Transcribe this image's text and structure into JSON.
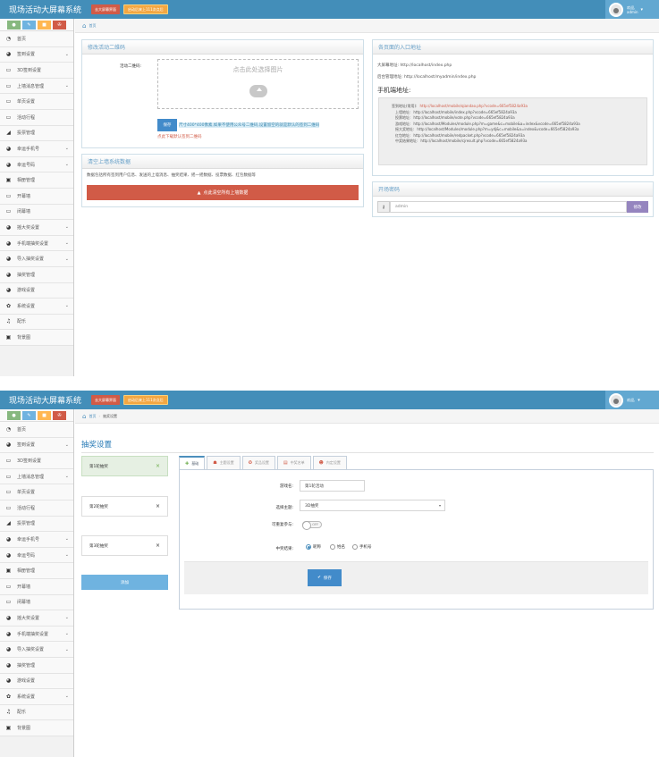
{
  "app": {
    "title": "现场活动大屏幕系统",
    "btn_screen": "去大屏幕界面",
    "btn_hint": "启动后来上111次点后",
    "user_greeting": "欢迎,",
    "user_name": "admin"
  },
  "sidebar": {
    "items": [
      {
        "icon": "tachometer-icon",
        "glyph": "◔",
        "label": "首页",
        "arrow": false
      },
      {
        "icon": "users-icon",
        "glyph": "◕",
        "label": "签到设置",
        "arrow": true
      },
      {
        "icon": "desktop-icon",
        "glyph": "▭",
        "label": "3D签到设置",
        "arrow": false
      },
      {
        "icon": "desktop-icon",
        "glyph": "▭",
        "label": "上墙消息管理",
        "arrow": true
      },
      {
        "icon": "desktop-icon",
        "glyph": "▭",
        "label": "单页设置",
        "arrow": false
      },
      {
        "icon": "desktop-icon",
        "glyph": "▭",
        "label": "活动行程",
        "arrow": false
      },
      {
        "icon": "bar-chart-icon",
        "glyph": "◢",
        "label": "投票管理",
        "arrow": false
      },
      {
        "icon": "users-icon",
        "glyph": "◕",
        "label": "幸运手机号",
        "arrow": true
      },
      {
        "icon": "users-icon",
        "glyph": "◕",
        "label": "幸运号码",
        "arrow": true
      },
      {
        "icon": "picture-icon",
        "glyph": "▣",
        "label": "相册管理",
        "arrow": false
      },
      {
        "icon": "desktop-icon",
        "glyph": "▭",
        "label": "开幕墙",
        "arrow": false
      },
      {
        "icon": "desktop-icon",
        "glyph": "▭",
        "label": "闭幕墙",
        "arrow": false
      },
      {
        "icon": "users-icon",
        "glyph": "◕",
        "label": "摇大奖设置",
        "arrow": true
      },
      {
        "icon": "users-icon",
        "glyph": "◕",
        "label": "手机端抽奖设置",
        "arrow": true
      },
      {
        "icon": "users-icon",
        "glyph": "◕",
        "label": "导入抽奖设置",
        "arrow": true
      },
      {
        "icon": "users-icon",
        "glyph": "◕",
        "label": "抽奖管理",
        "arrow": false
      },
      {
        "icon": "users-icon",
        "glyph": "◕",
        "label": "游戏设置",
        "arrow": false
      },
      {
        "icon": "gear-icon",
        "glyph": "✿",
        "label": "系统设置",
        "arrow": true
      },
      {
        "icon": "music-icon",
        "glyph": "♫",
        "label": "配乐",
        "arrow": false
      },
      {
        "icon": "picture-icon",
        "glyph": "▣",
        "label": "背景图",
        "arrow": false
      }
    ]
  },
  "shortcuts": [
    {
      "icon": "signal-icon",
      "glyph": "●",
      "color": "#87b87f"
    },
    {
      "icon": "pencil-icon",
      "glyph": "✎",
      "color": "#6fb3e0"
    },
    {
      "icon": "group-icon",
      "glyph": "■",
      "color": "#ffb752"
    },
    {
      "icon": "cogs-icon",
      "glyph": "✇",
      "color": "#d15b47"
    }
  ],
  "screen1": {
    "breadcrumb": {
      "home": "首页"
    },
    "qr": {
      "title": "修改活动二维码",
      "label": "活动二维码:",
      "upload_text": "点击此处选择图片",
      "save": "保存",
      "note": "尺寸400*400像素,如果不使用公众号二维码,设置留空的就是默认的签到二维码",
      "default_link": "点此下载默认签到二维码"
    },
    "clear": {
      "title": "清空上墙系统数据",
      "desc": "数据包括所有签到用户信息、发送的上墙消息、抽奖结果、摇一摇数据、投票数据、红包数据等",
      "button": "点此清空所有上墙数据"
    },
    "entry": {
      "title": "各页面的入口地址",
      "screen_addr": "大屏幕地址:  http://localhost/index.php",
      "admin_addr": "后台管理地址:  http://localhost/myadmin/index.php",
      "mobile_title": "手机端地址:",
      "lines": [
        {
          "label": "签到地址(常用):",
          "url": "http://localhost/mobile/qiandao.php?vcode=665ef5824a93a",
          "red": true
        },
        {
          "label": "上墙地址:",
          "url": "http://localhost/mobile/index.php?vcode=665ef5824a93a",
          "red": false
        },
        {
          "label": "投票地址:",
          "url": "http://localhost/mobile/vote.php?vcode=665ef5824a93a",
          "red": false
        },
        {
          "label": "游戏地址:",
          "url": "http://localhost/Modules/module.php?m=game&c=mobile&a=index&vcode=665ef5824a93a",
          "red": false
        },
        {
          "label": "摇大奖地址:",
          "url": "http://localhost/Modules/module.php?m=ydj&c=mobile&a=index&vcode=665ef5824a93a",
          "red": false
        },
        {
          "label": "红包地址:",
          "url": "http://localhost/mobile/redpacket.php?vcode=665ef5824a93a",
          "red": false
        },
        {
          "label": "中奖结果地址:",
          "url": "http://localhost/mobile/cjresult.php?vcode=665ef5824a93a",
          "red": false
        }
      ]
    },
    "password": {
      "title": "开场密码",
      "value": "admin",
      "button": "修改"
    }
  },
  "screen2": {
    "breadcrumb": {
      "home": "首页",
      "current": "抽奖设置"
    },
    "page_title": "抽奖设置",
    "rounds": [
      {
        "label": "第1轮抽奖",
        "active": true
      },
      {
        "label": "第2轮抽奖",
        "active": false
      },
      {
        "label": "第3轮抽奖",
        "active": false
      }
    ],
    "add_button": "添加",
    "tabs": [
      {
        "icon": "plus-circle-icon",
        "glyph": "✚",
        "label": "基础",
        "active": true
      },
      {
        "icon": "car-icon",
        "glyph": "☗",
        "label": "主题设置",
        "active": false
      },
      {
        "icon": "award-icon",
        "glyph": "✪",
        "label": "奖品设置",
        "active": false
      },
      {
        "icon": "list-icon",
        "glyph": "▤",
        "label": "中奖名单",
        "active": false
      },
      {
        "icon": "user-icon",
        "glyph": "☻",
        "label": "内定设置",
        "active": false
      }
    ],
    "form": {
      "name_label": "游戏名:",
      "name_value": "第1轮活动",
      "theme_label": "选择主题:",
      "theme_value": "3D抽奖",
      "repeat_label": "可重复参与:",
      "repeat_value": "OFF",
      "result_label": "中奖结果:",
      "result_options": [
        {
          "label": "昵称",
          "checked": true
        },
        {
          "label": "姓名",
          "checked": false
        },
        {
          "label": "手机号",
          "checked": false
        }
      ],
      "save": "保存"
    }
  }
}
